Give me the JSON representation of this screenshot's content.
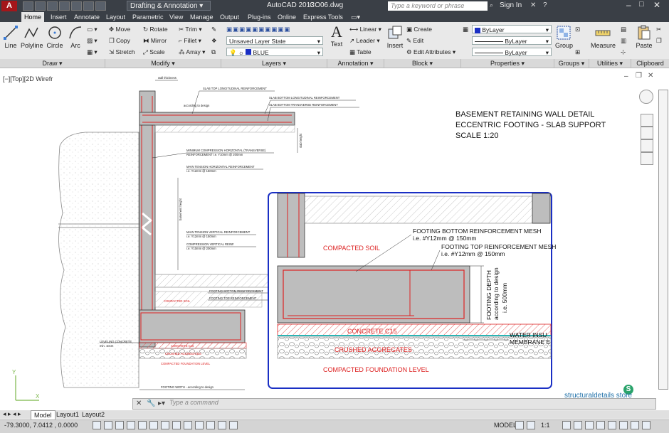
{
  "titlebar": {
    "workspace": "Drafting & Annotation",
    "app_title": "AutoCAD 2013",
    "file_name": "CO06.dwg",
    "search_placeholder": "Type a keyword or phrase",
    "sign_in": "Sign In"
  },
  "ribbon_tabs": [
    "Home",
    "Insert",
    "Annotate",
    "Layout",
    "Parametric",
    "View",
    "Manage",
    "Output",
    "Plug-ins",
    "Online",
    "Express Tools"
  ],
  "panels": {
    "draw": {
      "title": "Draw",
      "line": "Line",
      "polyline": "Polyline",
      "circle": "Circle",
      "arc": "Arc"
    },
    "modify": {
      "title": "Modify",
      "move": "Move",
      "rotate": "Rotate",
      "trim": "Trim",
      "copy": "Copy",
      "mirror": "Mirror",
      "fillet": "Fillet",
      "stretch": "Stretch",
      "scale": "Scale",
      "array": "Array"
    },
    "layers": {
      "title": "Layers",
      "state": "Unsaved Layer State",
      "layer": "BLUE"
    },
    "annotation": {
      "title": "Annotation",
      "text": "Text",
      "linear": "Linear",
      "leader": "Leader",
      "table": "Table"
    },
    "block": {
      "title": "Block",
      "insert": "Insert",
      "create": "Create",
      "edit": "Edit",
      "edit_attributes": "Edit Attributes"
    },
    "properties": {
      "title": "Properties",
      "color": "ByLayer",
      "linetype": "ByLayer",
      "lineweight": "ByLayer"
    },
    "groups": {
      "title": "Groups",
      "group": "Group"
    },
    "utilities": {
      "title": "Utilities",
      "measure": "Measure"
    },
    "clipboard": {
      "title": "Clipboard",
      "paste": "Paste"
    }
  },
  "viewport": {
    "label": "[−][Top][2D Wirefr",
    "title_lines": [
      "BASEMENT RETAINING WALL DETAIL",
      "ECCENTRIC FOOTING - SLAB SUPPORT",
      "SCALE 1:20"
    ],
    "small_labels": {
      "wall_thickness": "wall thickness",
      "slab_top": "SLAB TOP LONGITUDINAL REINFORCEMENT",
      "according": "according to design",
      "slab_bottom_long": "SLAB BOTTOM LONGITUDINAL REINFORCEMENT",
      "slab_bottom_trans": "SLAB BOTTOM TRANSVERSE REINFORCEMENT",
      "min_comp_h": "MINIMUM COMPRESSION HORIZONTAL (TRANSVERSE)",
      "min_comp_h2": "REINFORCEMENT i.e. Y10mm @ 200mm",
      "main_tension_h": "MAIN TENSION HORIZONTAL REINFORCEMENT",
      "main_tension_h2": "i.e. Y12mm @ 150mm",
      "main_tension_v": "MAIN TENSION VERTICAL REINFORCEMENT",
      "main_tension_v2": "i.e. Y12mm @ 150mm",
      "comp_v": "COMPRESSION VERTICAL REINF.",
      "comp_v2": "i.e. Y10mm @ 200mm",
      "basement_height": "basement height",
      "footing_bottom": "FOOTING BOTTOM REINFORCEMENT",
      "footing_top": "FOOTING TOP REINFORCEMENT",
      "compacted_soil": "COMPACTED SOIL",
      "leveling": "LEVELING CONCRETE",
      "leveling2": "min. 10cm",
      "concrete": "CONCRETE C15",
      "crushed": "CRUSHED AGGREGATES",
      "foundation": "COMPACTED FOUNDATION LEVEL",
      "footing_width": "FOOTING WIDTH - according to design",
      "slab_height": "slab height"
    },
    "zoom": {
      "footing_bottom": "FOOTING BOTTOM REINFORCEMENT MESH",
      "footing_bottom_spec": "i.e. #Y12mm @ 150mm",
      "footing_top": "FOOTING TOP REINFORCEMENT MESH",
      "footing_top_spec": "i.e. #Y12mm @ 150mm",
      "compacted_soil": "COMPACTED SOIL",
      "footing_depth": "FOOTING DEPTH",
      "footing_depth2": "according to design",
      "footing_depth3": "i.e. 500mm",
      "concrete": "CONCRETE C15",
      "water": "WATER INSU",
      "membrane": "MEMBRANE E",
      "crushed": "CRUSHED AGGREGATES",
      "foundation": "COMPACTED FOUNDATION LEVEL"
    },
    "brand": "structuraldetails store"
  },
  "command": {
    "placeholder": "Type a command"
  },
  "layout_tabs": [
    "Model",
    "Layout1",
    "Layout2"
  ],
  "status": {
    "coords": "-79.3000, 7.0412 , 0.0000",
    "model": "MODEL",
    "scale": "1:1"
  },
  "colors": {
    "accent_blue": "#1a2fc4",
    "rebar_red": "#d22",
    "concrete_gray": "#bdbdbd",
    "ribbon": "#e9e9e9",
    "titlebar": "#3a3f46"
  }
}
